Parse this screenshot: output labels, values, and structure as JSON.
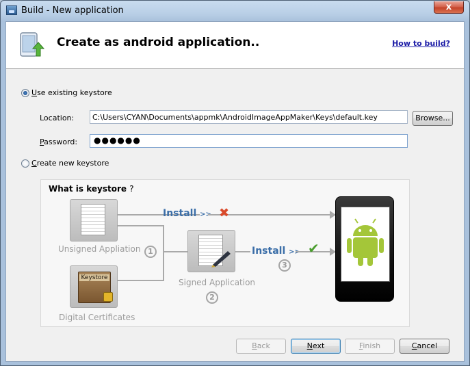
{
  "window": {
    "title": "Build - New application",
    "close_glyph": "x"
  },
  "header": {
    "title": "Create as android application..",
    "help_link": "How to build?",
    "icon": "tablet-upload-icon"
  },
  "keystore": {
    "use_existing_label": "Use existing keystore",
    "use_existing_checked": true,
    "location_label": "Location:",
    "location_value": "C:\\Users\\CYAN\\Documents\\appmk\\AndroidImageAppMaker\\Keys\\default.key",
    "browse_label": "Browse...",
    "password_label": "Password:",
    "password_value": "●●●●●●",
    "create_new_label": "Create new keystore",
    "create_new_checked": false
  },
  "diagram": {
    "title": "What is keystore",
    "title_mark": "?",
    "unsigned_label": "Unsigned Appliation",
    "digital_label": "Digital Certificates",
    "signed_label": "Signed Application",
    "keystore_text": "Keystore",
    "install_label": "Install",
    "install_arrows": ">>",
    "step1": "1",
    "step2": "2",
    "step3": "3",
    "fail_mark": "✖",
    "ok_mark": "✔"
  },
  "buttons": {
    "back": "Back",
    "next": "Next",
    "finish": "Finish",
    "cancel": "Cancel"
  },
  "colors": {
    "link": "#1a1aa6",
    "install_text": "#3b6ea8",
    "fail": "#d9492a",
    "ok": "#4a9d2e",
    "android_green": "#a4c639"
  }
}
